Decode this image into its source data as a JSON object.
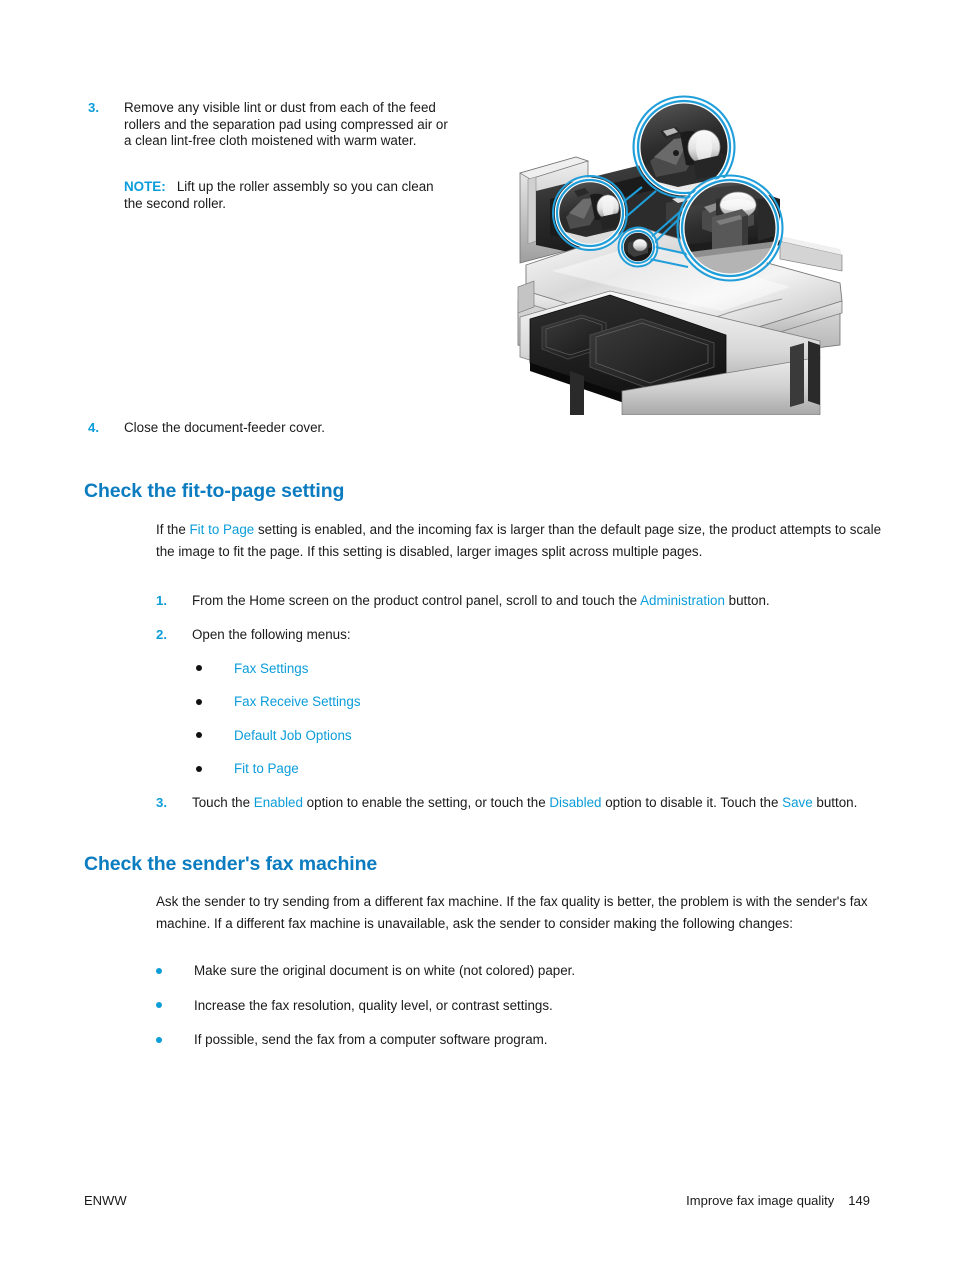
{
  "page": {
    "accent_color": "#0b9dd9",
    "heading_color": "#0b7cc0",
    "text_color": "#1a1a1a",
    "background": "#ffffff"
  },
  "steps_top": {
    "step3": {
      "number": "3.",
      "text": "Remove any visible lint or dust from each of the feed rollers and the separation pad using compressed air or a clean lint-free cloth moistened with warm water."
    },
    "note": {
      "label": "NOTE:",
      "text": "Lift up the roller assembly so you can clean the second roller."
    },
    "step4": {
      "number": "4.",
      "text": "Close the document-feeder cover."
    }
  },
  "illustration": {
    "name": "document-feeder-rollers-diagram",
    "callout_color": "#1f9ed9"
  },
  "section_fit_to_page": {
    "heading": "Check the fit-to-page setting",
    "intro": {
      "part1": "If the ",
      "link1": "Fit to Page",
      "part2": " setting is enabled, and the incoming fax is larger than the default page size, the product attempts to scale the image to fit the page. If this setting is disabled, larger images split across multiple pages."
    },
    "steps": [
      {
        "number": "1.",
        "part1": "From the Home screen on the product control panel, scroll to and touch the ",
        "link": "Administration",
        "part2": " button."
      },
      {
        "number": "2.",
        "part1": "Open the following menus:",
        "link": "",
        "part2": ""
      }
    ],
    "menus": [
      "Fax Settings",
      "Fax Receive Settings",
      "Default Job Options",
      "Fit to Page"
    ],
    "step3": {
      "number": "3.",
      "part1": "Touch the ",
      "link1": "Enabled",
      "part2": " option to enable the setting, or touch the ",
      "link2": "Disabled",
      "part3": " option to disable it. Touch the ",
      "link3": "Save",
      "part4": " button."
    }
  },
  "section_sender_fax": {
    "heading": "Check the sender's fax machine",
    "intro": "Ask the sender to try sending from a different fax machine. If the fax quality is better, the problem is with the sender's fax machine. If a different fax machine is unavailable, ask the sender to consider making the following changes:",
    "bullets": [
      "Make sure the original document is on white (not colored) paper.",
      "Increase the fax resolution, quality level, or contrast settings.",
      "If possible, send the fax from a computer software program."
    ]
  },
  "footer": {
    "left": "ENWW",
    "chapter": "Improve fax image quality",
    "page_number": "149"
  }
}
